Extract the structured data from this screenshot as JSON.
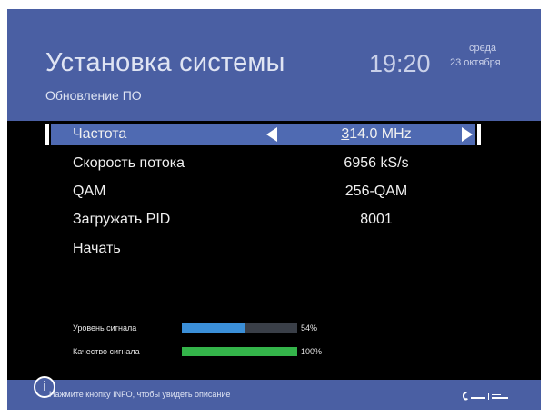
{
  "header": {
    "title": "Установка системы",
    "subtitle": "Обновление ПО",
    "time": "19:20",
    "day": "среда",
    "date": "23 октября"
  },
  "menu": {
    "items": [
      {
        "label": "Частота",
        "value": "314.0 MHz",
        "selected": true
      },
      {
        "label": "Скорость потока",
        "value": "6956 kS/s"
      },
      {
        "label": "QAM",
        "value": "256-QAM"
      },
      {
        "label": "Загружать PID",
        "value": "8001"
      },
      {
        "label": "Начать",
        "value": ""
      }
    ]
  },
  "signal": {
    "level_label": "Уровень сигнала",
    "level_percent": "54%",
    "level_value": 54,
    "level_color": "#3b8fd8",
    "quality_label": "Качество сигнала",
    "quality_percent": "100%",
    "quality_value": 100,
    "quality_color": "#34b44a"
  },
  "footer": {
    "info_icon": "info-icon",
    "hint": "Нажмите кнопку INFO, чтобы увидеть описание"
  },
  "colors": {
    "header_bg": "#4a5fa3",
    "selected_row_bg": "#4f6ab2"
  }
}
